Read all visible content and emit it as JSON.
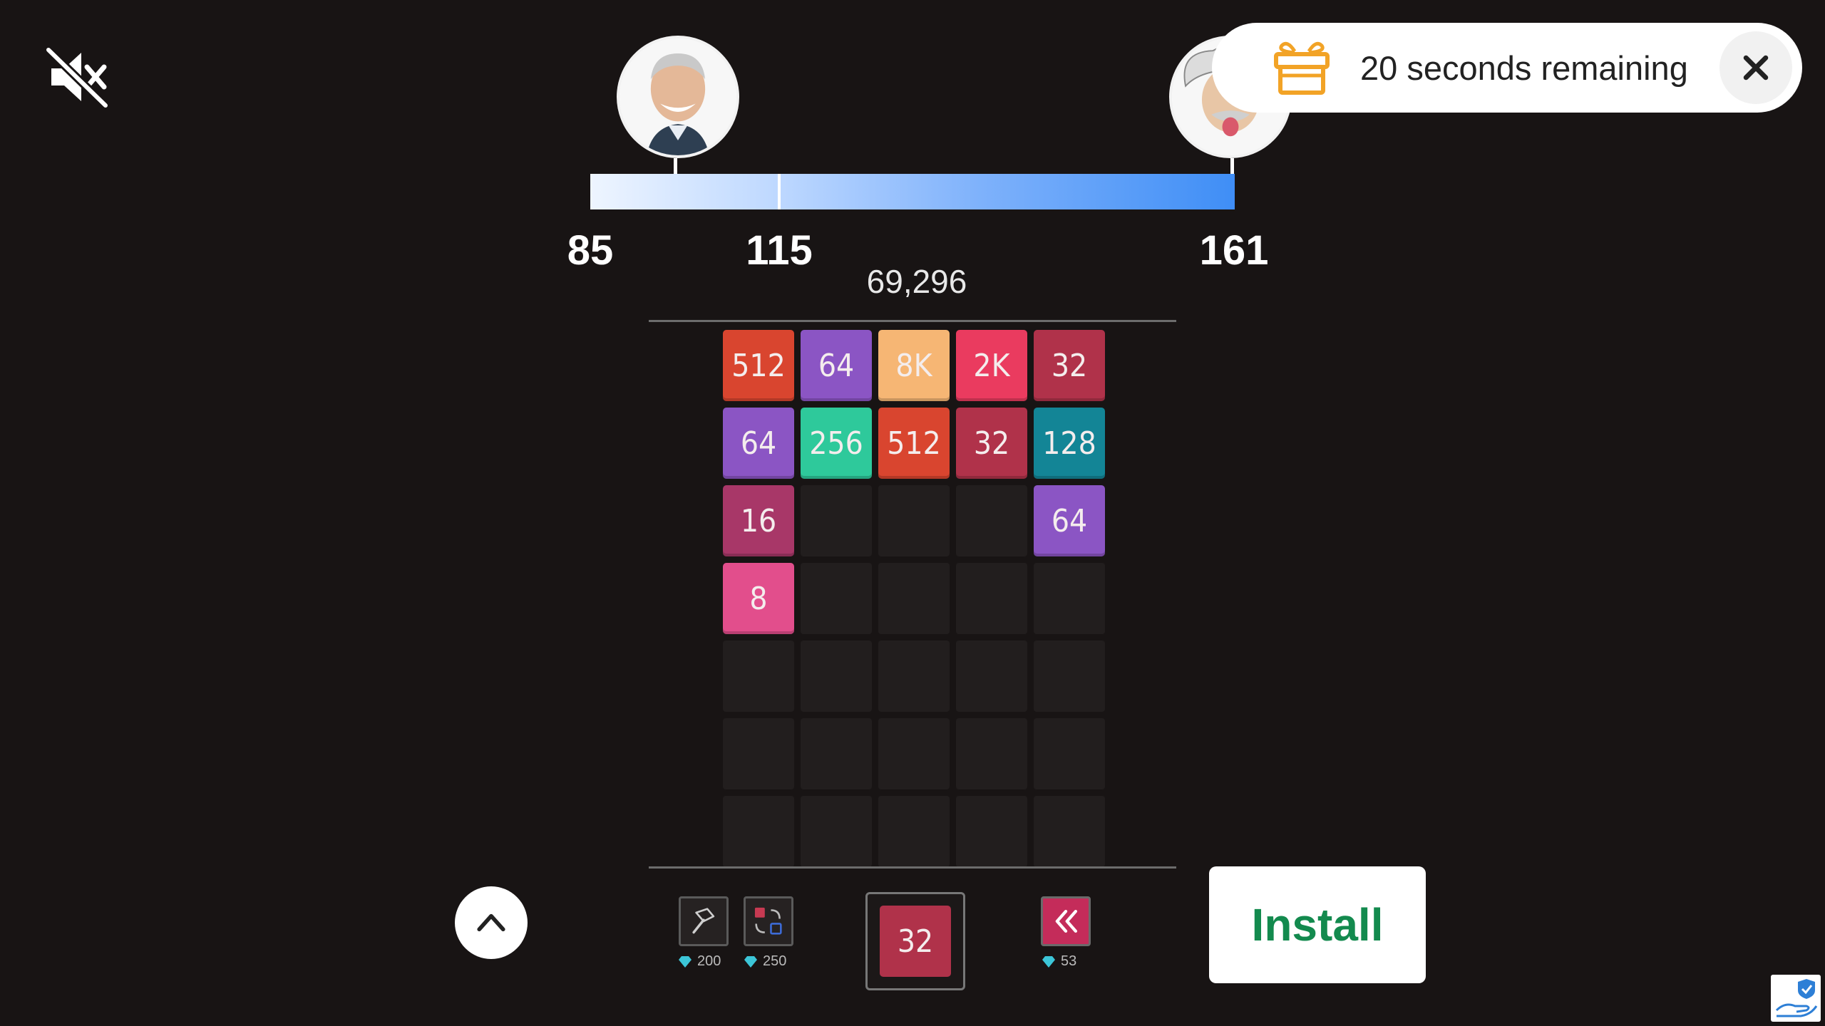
{
  "toast": {
    "text": "20 seconds remaining"
  },
  "progress": {
    "milestones": [
      "85",
      "115",
      "161"
    ],
    "score": "69,296",
    "fill_fraction": 0.29
  },
  "board": {
    "columns": 5,
    "rows": 7,
    "tiles": [
      [
        {
          "v": "512",
          "c": "#d9452f"
        },
        {
          "v": "64",
          "c": "#8b55c4"
        },
        {
          "v": "8K",
          "c": "#f6b674"
        },
        {
          "v": "2K",
          "c": "#ea3b5f"
        },
        {
          "v": "32",
          "c": "#b0324a"
        }
      ],
      [
        {
          "v": "64",
          "c": "#8b55c4"
        },
        {
          "v": "256",
          "c": "#2ec99b"
        },
        {
          "v": "512",
          "c": "#d9452f"
        },
        {
          "v": "32",
          "c": "#b0324a"
        },
        {
          "v": "128",
          "c": "#138596"
        }
      ],
      [
        {
          "v": "16",
          "c": "#a83768"
        },
        null,
        null,
        null,
        {
          "v": "64",
          "c": "#8b55c4"
        }
      ],
      [
        {
          "v": "8",
          "c": "#e24e8c"
        },
        null,
        null,
        null,
        null
      ],
      [
        null,
        null,
        null,
        null,
        null
      ],
      [
        null,
        null,
        null,
        null,
        null
      ],
      [
        null,
        null,
        null,
        null,
        null
      ]
    ]
  },
  "boosters": {
    "hammer_cost": "200",
    "swap_cost": "250",
    "undo_cost": "53"
  },
  "next_tile": {
    "value": "32"
  },
  "install": {
    "label": "Install"
  },
  "colors": {
    "gem": "#3cc6d8",
    "undo_booster": "#c42c5a",
    "install_text": "#138a4e"
  }
}
